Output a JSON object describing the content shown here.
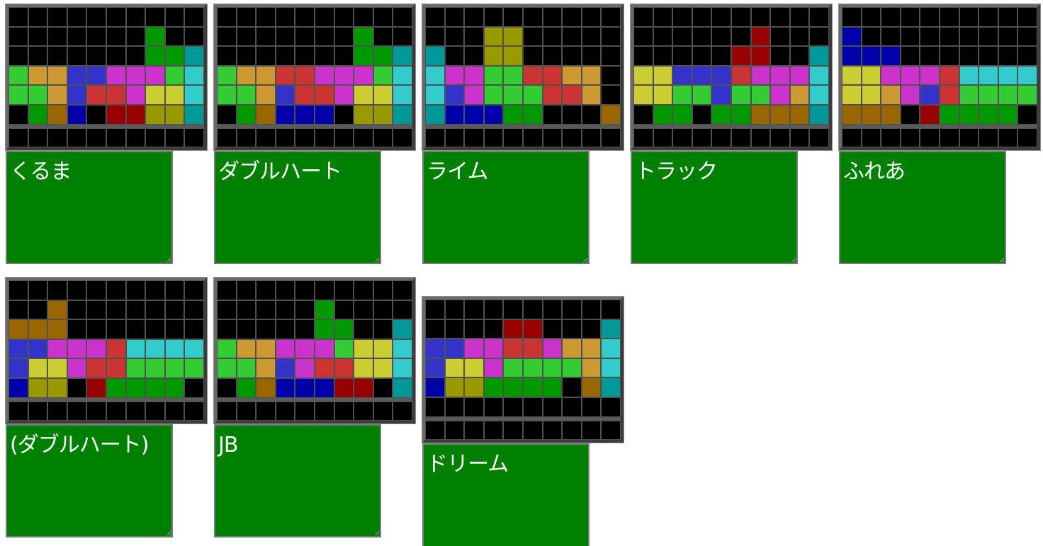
{
  "palette": {
    "k": "#000000",
    "g": "#33cc33",
    "G": "#009900",
    "o": "#cc9933",
    "O": "#996600",
    "b": "#3333cc",
    "B": "#0000aa",
    "r": "#cc3333",
    "R": "#990000",
    "m": "#cc33cc",
    "y": "#cccc33",
    "Y": "#999900",
    "c": "#33cccc",
    "C": "#009999"
  },
  "cards": [
    {
      "label": "くるま",
      "rows": [
        "kkkkkkkkkk",
        "kkkkkkkGkk",
        "kkkkkkkGGC",
        "goobbmmmgc",
        "ggobrrmyyc",
        "kGOBkRRYYC"
      ],
      "next": "kkkkkkkkkk"
    },
    {
      "label": "ダブルハート",
      "rows": [
        "kkkkkkkkkk",
        "kkkkkkkGkk",
        "kkkkkkkGGC",
        "goorrmmmgc",
        "ggobrrmyyc",
        "kGOBBBkYYC"
      ],
      "next": "kkkkkkkkkk"
    },
    {
      "label": "ライム",
      "rows": [
        "kkkkkkkkkk",
        "kkkYYkkkkk",
        "CkkYYkkkkk",
        "cmmggrroo",
        "cbmgggrro",
        "CBBBGGkkkO"
      ],
      "next": "kkkkkkkkkk"
    },
    {
      "label": "トラック",
      "rows": [
        "kkkkkkkkkk",
        "kkkkkkRkkk",
        "kkkkkRRkkC",
        "yybbbrmmmc",
        "yyggbggmoc",
        "kGGkGGOOOC"
      ],
      "next": "kkkkkkkkkk"
    },
    {
      "label": "ふれあ",
      "rows": [
        "kkkkkkkkkk",
        "Bkkkkkkkkk",
        "BBBkkkkkkk",
        "yymmmrcccc",
        "yyombrgggg",
        "OOOkRGGGGk"
      ],
      "next": "kkkkkkkkkk"
    },
    {
      "label": "(ダブルハート)",
      "rows": [
        "kkkkkkkkkk",
        "kkOkkkkkkk",
        "OOOkkkkkkk",
        "bbmmmrcccc",
        "byymrrgggg",
        "BYYkRGGGGk"
      ],
      "next": "kkkkkkkkkk"
    },
    {
      "label": "JB",
      "rows": [
        "kkkkkkkkkk",
        "kkkkkGkkkk",
        "kkkkkGGkkC",
        "goommmgyyc",
        "ggobmrryyc",
        "kGOBBBRRkC"
      ],
      "next": "kkkkkkkkkk"
    },
    {
      "label": "ドリーム",
      "rows": [
        "kkkkkkkkkk",
        "kkkkRRkkkC",
        "bbmmrroo",
        "byymgggg",
        "BYYGGGGkOC",
        "kkkkkkkkkk"
      ],
      "next": "kkkkkkkkkk"
    }
  ]
}
